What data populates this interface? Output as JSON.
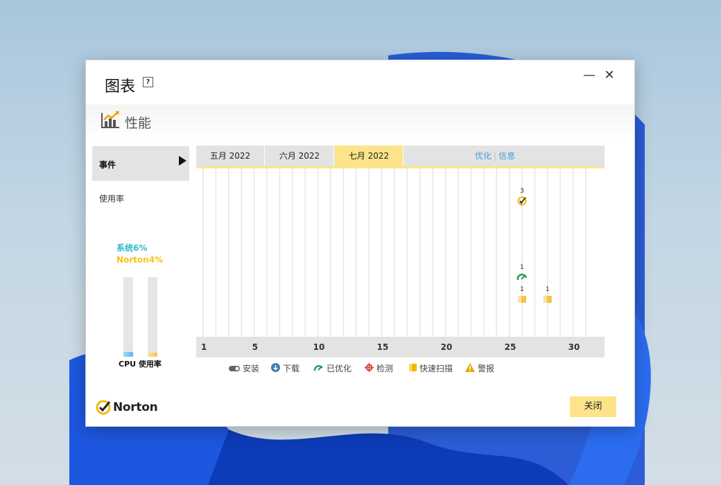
{
  "window": {
    "title": "图表",
    "help_symbol": "?",
    "minimize_symbol": "—",
    "close_symbol": "✕"
  },
  "section": {
    "label": "性能",
    "icon": "performance-chart-icon"
  },
  "sidebar": {
    "tabs": [
      {
        "label": "事件",
        "selected": true
      },
      {
        "label": "使用率",
        "selected": false
      }
    ],
    "cpu": {
      "system_label": "系统6%",
      "norton_label": "Norton4%",
      "system_percent": 6,
      "norton_percent": 4,
      "caption": "CPU 使用率",
      "system_color": "#35b7d2",
      "norton_color": "#f5c518"
    }
  },
  "chart": {
    "month_tabs": [
      {
        "label": "五月 2022",
        "selected": false
      },
      {
        "label": "六月 2022",
        "selected": false
      },
      {
        "label": "七月 2022",
        "selected": true
      }
    ],
    "links": {
      "optimize": "优化",
      "info": "信息"
    },
    "accent": "#fde48a"
  },
  "chart_data": {
    "type": "scatter",
    "x_range": [
      1,
      31
    ],
    "x_ticks": [
      "1",
      "5",
      "10",
      "15",
      "20",
      "25",
      "30"
    ],
    "events": [
      {
        "day": 26,
        "category": "detect",
        "count": "3",
        "icon": "checkmark-circle-icon"
      },
      {
        "day": 26,
        "category": "optimized",
        "count": "1",
        "icon": "speedometer-icon"
      },
      {
        "day": 26,
        "category": "quick_scan",
        "count": "1",
        "icon": "quick-scan-icon"
      },
      {
        "day": 28,
        "category": "quick_scan",
        "count": "1",
        "icon": "quick-scan-icon"
      }
    ]
  },
  "legend": [
    {
      "label": "安装",
      "icon": "install-icon"
    },
    {
      "label": "下载",
      "icon": "download-icon"
    },
    {
      "label": "已优化",
      "icon": "optimized-icon"
    },
    {
      "label": "检测",
      "icon": "detection-icon"
    },
    {
      "label": "快速扫描",
      "icon": "quick-scan-icon"
    },
    {
      "label": "警报",
      "icon": "alert-icon"
    }
  ],
  "footer": {
    "brand": "Norton",
    "close_label": "关闭"
  }
}
